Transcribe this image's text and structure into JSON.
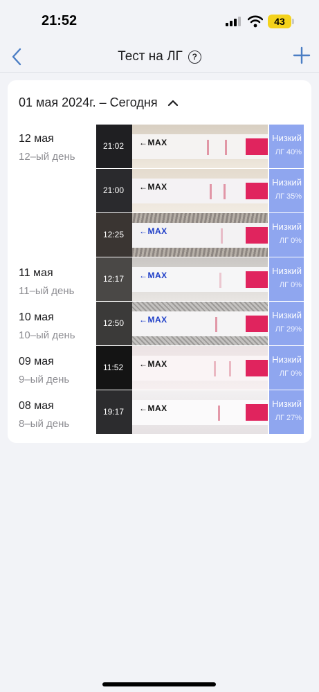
{
  "status": {
    "time": "21:52",
    "battery": "43"
  },
  "nav": {
    "title": "Тест на ЛГ",
    "help": "?"
  },
  "range": {
    "label": "01 мая 2024г. – Сегодня"
  },
  "days": [
    {
      "date": "12 мая",
      "day": "12–ый день"
    },
    {
      "date": "11 мая",
      "day": "11–ый день"
    },
    {
      "date": "10 мая",
      "day": "10–ый день"
    },
    {
      "date": "09 мая",
      "day": "9–ый день"
    },
    {
      "date": "08 мая",
      "day": "8–ый день"
    }
  ],
  "tests": [
    {
      "time": "21:02",
      "max": "MAX",
      "result": "Низкий",
      "level": "ЛГ 40%"
    },
    {
      "time": "21:00",
      "max": "MAX",
      "result": "Низкий",
      "level": "ЛГ 35%"
    },
    {
      "time": "12:25",
      "max": "MAX",
      "result": "Низкий",
      "level": "ЛГ 0%"
    },
    {
      "time": "12:17",
      "max": "MAX",
      "result": "Низкий",
      "level": "ЛГ 0%"
    },
    {
      "time": "12:50",
      "max": "MAX",
      "result": "Низкий",
      "level": "ЛГ 29%"
    },
    {
      "time": "11:52",
      "max": "MAX",
      "result": "Низкий",
      "level": "ЛГ 0%"
    },
    {
      "time": "19:17",
      "max": "MAX",
      "result": "Низкий",
      "level": "ЛГ 27%"
    }
  ]
}
